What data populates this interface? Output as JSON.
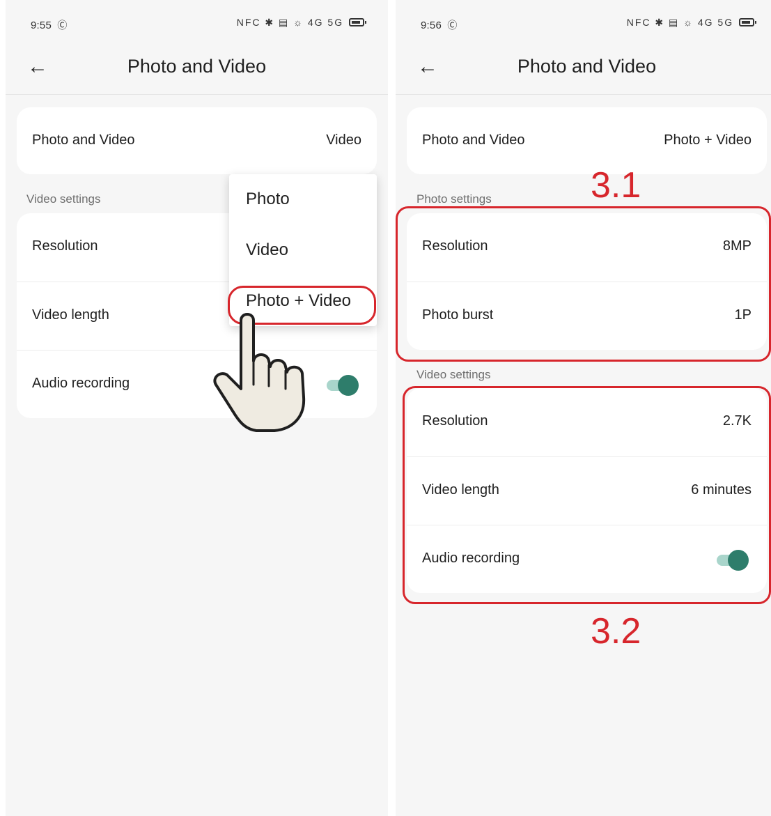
{
  "left_screen": {
    "status": {
      "time": "9:55",
      "clock_badge": "Ⓒ",
      "icons": "NFC  ✱ ▤ ☼ 4G 5G"
    },
    "app_bar": {
      "title": "Photo and Video"
    },
    "mode_row": {
      "label": "Photo and Video",
      "value": "Video"
    },
    "video_settings": {
      "title": "Video settings",
      "rows": [
        {
          "label": "Resolution"
        },
        {
          "label": "Video length"
        },
        {
          "label": "Audio recording",
          "toggle_on": true
        }
      ]
    },
    "dropdown": {
      "options": [
        "Photo",
        "Video",
        "Photo + Video"
      ],
      "highlighted_option": "Photo + Video"
    }
  },
  "right_screen": {
    "status": {
      "time": "9:56",
      "clock_badge": "Ⓒ",
      "icons": "NFC  ✱ ▤ ☼ 4G 5G"
    },
    "app_bar": {
      "title": "Photo and Video"
    },
    "mode_row": {
      "label": "Photo and Video",
      "value": "Photo + Video"
    },
    "photo_settings": {
      "title": "Photo settings",
      "rows": [
        {
          "label": "Resolution",
          "value": "8MP"
        },
        {
          "label": "Photo burst",
          "value": "1P"
        }
      ]
    },
    "video_settings": {
      "title": "Video settings",
      "rows": [
        {
          "label": "Resolution",
          "value": "2.7K"
        },
        {
          "label": "Video length",
          "value": "6 minutes"
        },
        {
          "label": "Audio recording",
          "toggle_on": true
        }
      ]
    }
  },
  "annotations": {
    "label_1": "3.1",
    "label_2": "3.2",
    "color": "#d7262c"
  },
  "colors": {
    "toggle_thumb": "#2e7d6b",
    "toggle_track": "#a9d5cb",
    "background": "#f6f6f6",
    "card": "#ffffff"
  },
  "icons": [
    "back-arrow-icon",
    "alarm-clock-icon",
    "nfc-icon",
    "bluetooth-icon",
    "vibrate-icon",
    "wifi-icon",
    "signal-icon",
    "battery-icon",
    "pointing-hand-icon"
  ]
}
